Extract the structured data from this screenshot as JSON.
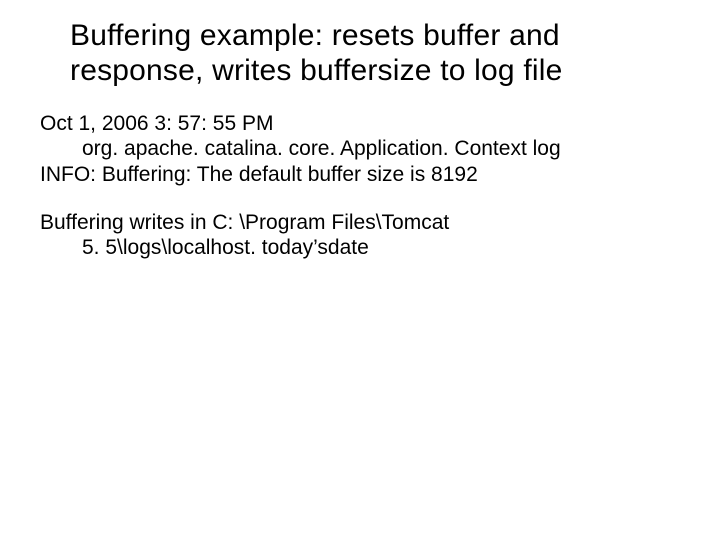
{
  "title_line1": "Buffering example: resets buffer and",
  "title_line2": "response, writes buffersize to log file",
  "log": {
    "line1": "Oct 1, 2006 3: 57: 55 PM",
    "line2": "org. apache. catalina. core. Application. Context log",
    "line3": "INFO: Buffering: The default buffer size is 8192"
  },
  "note": {
    "line1": "Buffering writes in C: \\Program Files\\Tomcat",
    "line2": "5. 5\\logs\\localhost. today’sdate"
  }
}
